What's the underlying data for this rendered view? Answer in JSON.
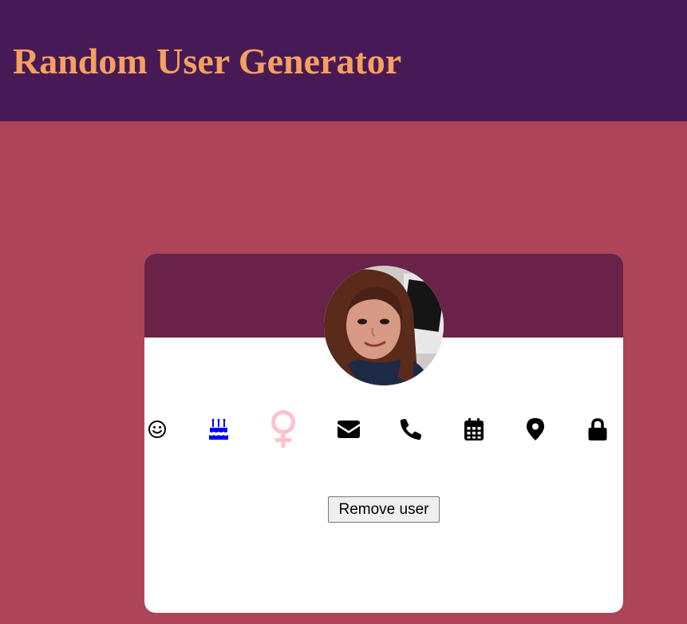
{
  "header": {
    "title": "Random User Generator"
  },
  "card": {
    "avatar_alt": "user photo",
    "icons": [
      {
        "name": "smile-icon",
        "color": "#000000"
      },
      {
        "name": "birthday-cake-icon",
        "color": "#0000ff"
      },
      {
        "name": "female-icon",
        "color": "#ffc0cb"
      },
      {
        "name": "envelope-icon",
        "color": "#000000"
      },
      {
        "name": "phone-icon",
        "color": "#000000"
      },
      {
        "name": "calendar-icon",
        "color": "#000000"
      },
      {
        "name": "map-marker-icon",
        "color": "#000000"
      },
      {
        "name": "lock-icon",
        "color": "#000000"
      }
    ],
    "remove_label": "Remove user"
  },
  "colors": {
    "page_background": "#ad4458",
    "header_background": "#481a55",
    "title_color": "#f5a05f",
    "card_banner": "#6b2249",
    "card_background": "#ffffff"
  }
}
